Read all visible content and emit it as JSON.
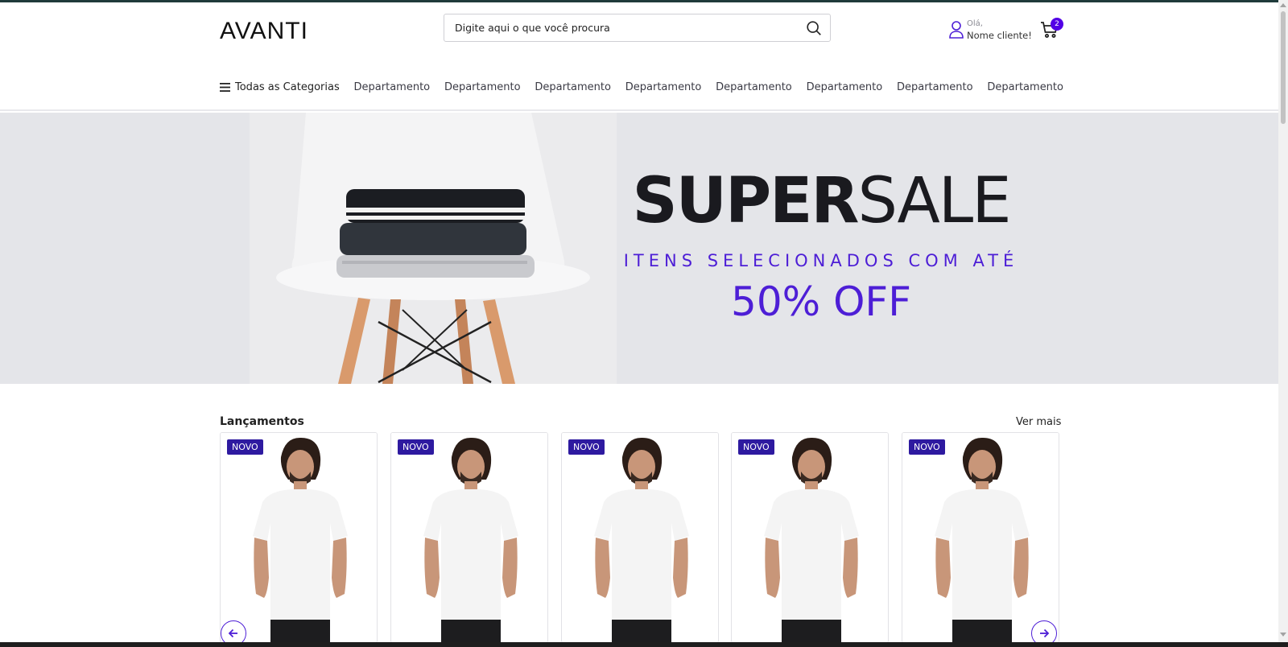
{
  "header": {
    "logo_text": "AVANTI",
    "search": {
      "placeholder": "Digite aqui o que você procura"
    },
    "account": {
      "hello": "Olá,",
      "name": "Nome cliente!"
    },
    "cart": {
      "count": "2"
    }
  },
  "nav": {
    "all_categories": "Todas as Categorias",
    "departments": [
      "Departamento",
      "Departamento",
      "Departamento",
      "Departamento",
      "Departamento",
      "Departamento",
      "Departamento",
      "Departamento"
    ]
  },
  "banner": {
    "title_bold": "SUPER",
    "title_light": "SALE",
    "subtitle": "ITENS SELECIONADOS COM ATÉ",
    "offer": "50% OFF"
  },
  "section": {
    "title": "Lançamentos",
    "see_more": "Ver mais",
    "products": [
      {
        "tag": "NOVO"
      },
      {
        "tag": "NOVO"
      },
      {
        "tag": "NOVO"
      },
      {
        "tag": "NOVO"
      },
      {
        "tag": "NOVO"
      }
    ]
  },
  "colors": {
    "accent": "#4d1ed6",
    "tag_bg": "#2e1aa0",
    "banner_bg": "#e4e5e9"
  },
  "icons": {
    "search": "search-icon",
    "user": "user-icon",
    "cart": "cart-icon",
    "menu": "menu-icon",
    "prev": "arrow-left-icon",
    "next": "arrow-right-icon"
  }
}
